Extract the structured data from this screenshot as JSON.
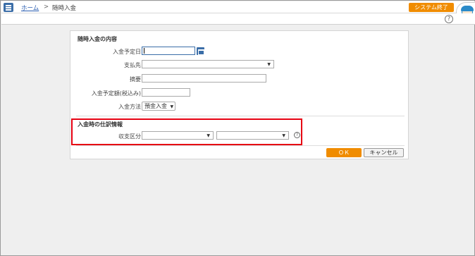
{
  "breadcrumb": {
    "home": "ホーム",
    "separator": ">",
    "current": "随時入金"
  },
  "header": {
    "exit_label": "システム終了",
    "help_label": "?"
  },
  "form": {
    "section_title": "随時入金の内容",
    "fields": {
      "scheduled_date_label": "入金予定日",
      "payer_label": "支払先",
      "summary_label": "摘要",
      "amount_label": "入金予定額(税込み)",
      "method_label": "入金方法",
      "method_value": "預金入金"
    },
    "journal_section_title": "入金時の仕訳情報",
    "category_label": "収支区分",
    "help_label": "?"
  },
  "buttons": {
    "ok": "ＯＫ",
    "cancel": "キャンセル"
  },
  "colors": {
    "accent": "#f08c00",
    "primary": "#3b6ea8",
    "highlight": "#e60012"
  }
}
